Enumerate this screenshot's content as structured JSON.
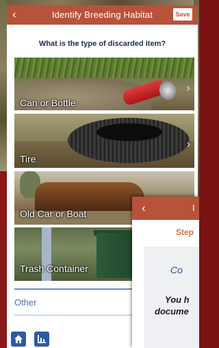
{
  "header": {
    "title": "Identify Breeding Habitat",
    "back_icon": "chevron-left-icon",
    "save_label": "Save"
  },
  "question": "What is the type of discarded item?",
  "options": [
    {
      "label": "Can or Bottle"
    },
    {
      "label": "Tire"
    },
    {
      "label": "Old Car or Boat"
    },
    {
      "label": "Trash Container"
    }
  ],
  "other_label": "Other",
  "bottom_nav": {
    "home_icon": "home-icon",
    "chart_icon": "bar-chart-icon"
  },
  "overlay_screen": {
    "title_fragment": "I",
    "step_fragment": "Step",
    "line1": "Co",
    "line2": "You h",
    "line3": "docume"
  },
  "colors": {
    "header": "#b6533a",
    "question_text": "#1e2a57",
    "link": "#4a72b8",
    "nav_button": "#2c5aa8",
    "step_text": "#d2703f"
  }
}
